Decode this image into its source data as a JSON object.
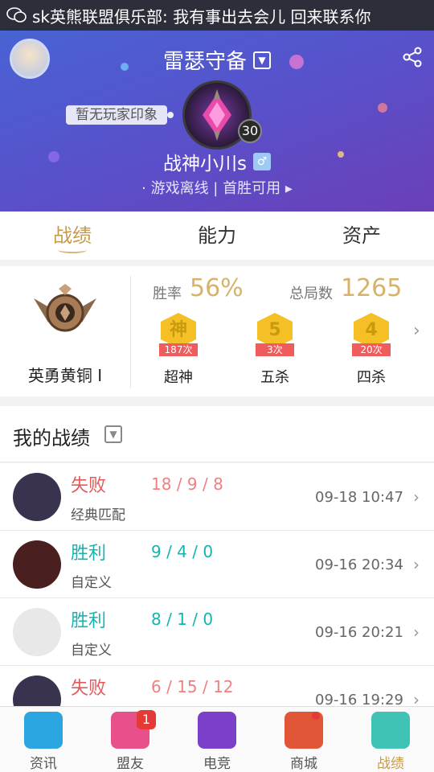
{
  "notification": {
    "text": "sk英熊联盟俱乐部: 我有事出去会儿 回来联系你"
  },
  "header": {
    "server": "雷瑟守备",
    "impression": "暂无玩家印象",
    "level": "30",
    "player_name": "战神小川s",
    "gender_symbol": "♂",
    "status": "· 游戏离线 | 首胜可用 ▸"
  },
  "tabs": [
    {
      "label": "战绩",
      "active": true
    },
    {
      "label": "能力",
      "active": false
    },
    {
      "label": "资产",
      "active": false
    }
  ],
  "stats": {
    "rank_name": "英勇黄铜 I",
    "win_rate_label": "胜率",
    "win_rate": "56%",
    "total_label": "总局数",
    "total_games": "1265",
    "badges": [
      {
        "glyph": "神",
        "count": "187次",
        "title": "超神"
      },
      {
        "glyph": "5",
        "count": "3次",
        "title": "五杀"
      },
      {
        "glyph": "4",
        "count": "20次",
        "title": "四杀"
      }
    ]
  },
  "my_records": {
    "title": "我的战绩",
    "matches": [
      {
        "result": "失败",
        "kda": "18 / 9 / 8",
        "mode": "经典匹配",
        "time": "09-18 10:47",
        "outcome": "loss",
        "avatar_color": "#3a3350"
      },
      {
        "result": "胜利",
        "kda": "9 / 4 / 0",
        "mode": "自定义",
        "time": "09-16 20:34",
        "outcome": "win",
        "avatar_color": "#4a1f1f"
      },
      {
        "result": "胜利",
        "kda": "8 / 1 / 0",
        "mode": "自定义",
        "time": "09-16 20:21",
        "outcome": "win",
        "avatar_color": "#e8e8e8"
      },
      {
        "result": "失败",
        "kda": "6 / 15 / 12",
        "mode": "",
        "time": "09-16 19:29",
        "outcome": "loss",
        "avatar_color": "#3a3350"
      }
    ]
  },
  "bottom_nav": [
    {
      "label": "资讯",
      "icon": "news-icon",
      "color": "#2ba6e0",
      "badge": "",
      "dot": false,
      "active": false
    },
    {
      "label": "盟友",
      "icon": "friends-icon",
      "color": "#e8508c",
      "badge": "1",
      "dot": false,
      "active": false
    },
    {
      "label": "电竞",
      "icon": "esports-icon",
      "color": "#7b3fc9",
      "badge": "",
      "dot": false,
      "active": false
    },
    {
      "label": "商城",
      "icon": "shop-icon",
      "color": "#e05636",
      "badge": "",
      "dot": true,
      "active": false
    },
    {
      "label": "战绩",
      "icon": "record-icon",
      "color": "#40c2b4",
      "badge": "",
      "dot": false,
      "active": true
    }
  ]
}
